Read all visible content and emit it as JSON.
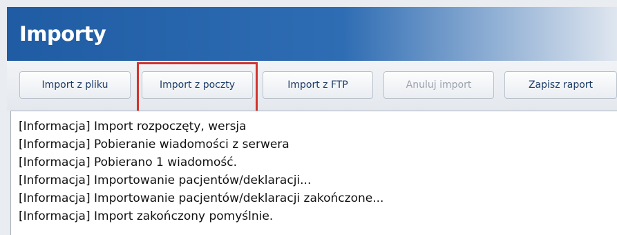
{
  "header": {
    "title": "Importy"
  },
  "toolbar": {
    "buttons": [
      {
        "label": "Import z pliku",
        "enabled": true
      },
      {
        "label": "Import z poczty",
        "enabled": true,
        "highlighted": true
      },
      {
        "label": "Import z FTP",
        "enabled": true
      },
      {
        "label": "Anuluj import",
        "enabled": false
      },
      {
        "label": "Zapisz raport",
        "enabled": true
      }
    ]
  },
  "log": {
    "lines": [
      "[Informacja] Import rozpoczęty, wersja",
      "[Informacja] Pobieranie wiadomości z serwera",
      "[Informacja] Pobierano 1 wiadomość.",
      "[Informacja] Importowanie pacjentów/deklaracji...",
      "[Informacja] Importowanie pacjentów/deklaracji zakończone...",
      "[Informacja] Import zakończony pomyślnie."
    ]
  },
  "colors": {
    "header_blue": "#1f5ca3",
    "highlight_red": "#d3322b",
    "button_text": "#1d3c66",
    "disabled_text": "#9aa3ad"
  }
}
